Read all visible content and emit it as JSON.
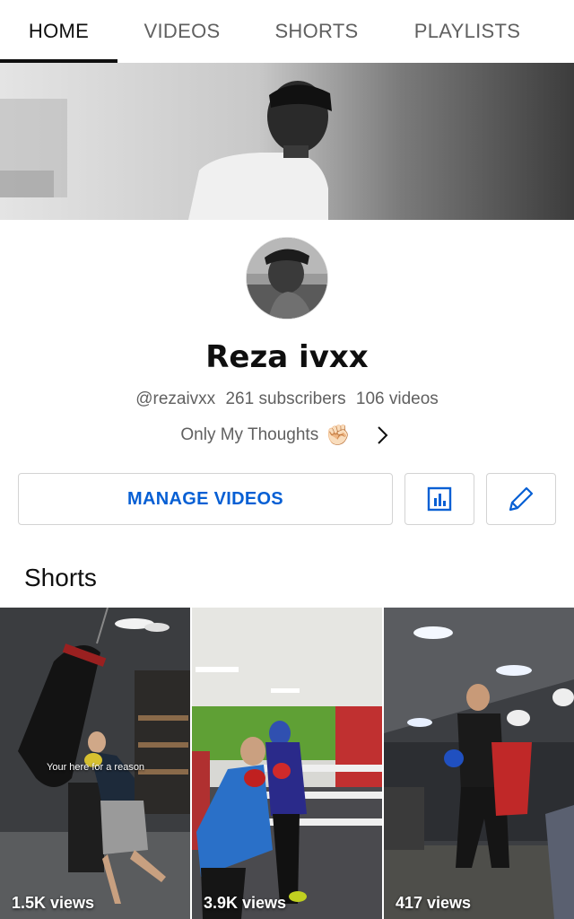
{
  "tabs": [
    {
      "label": "HOME",
      "active": true
    },
    {
      "label": "VIDEOS",
      "active": false
    },
    {
      "label": "SHORTS",
      "active": false
    },
    {
      "label": "PLAYLISTS",
      "active": false
    }
  ],
  "channel": {
    "name": "Reza ivxx",
    "handle": "@rezaivxx",
    "subscribers": "261 subscribers",
    "videos": "106 videos",
    "description": "Only My Thoughts",
    "description_emoji": "✊🏻"
  },
  "actions": {
    "manage_videos": "MANAGE VIDEOS",
    "analytics_icon": "analytics-icon",
    "edit_icon": "pencil-icon"
  },
  "shorts_section": {
    "title": "Shorts",
    "items": [
      {
        "views": "1.5K views",
        "overlay_text": "Your here for a reason"
      },
      {
        "views": "3.9K views"
      },
      {
        "views": "417 views"
      }
    ]
  },
  "colors": {
    "accent": "#065fd4",
    "text": "#0f0f0f",
    "secondary": "#606060"
  }
}
